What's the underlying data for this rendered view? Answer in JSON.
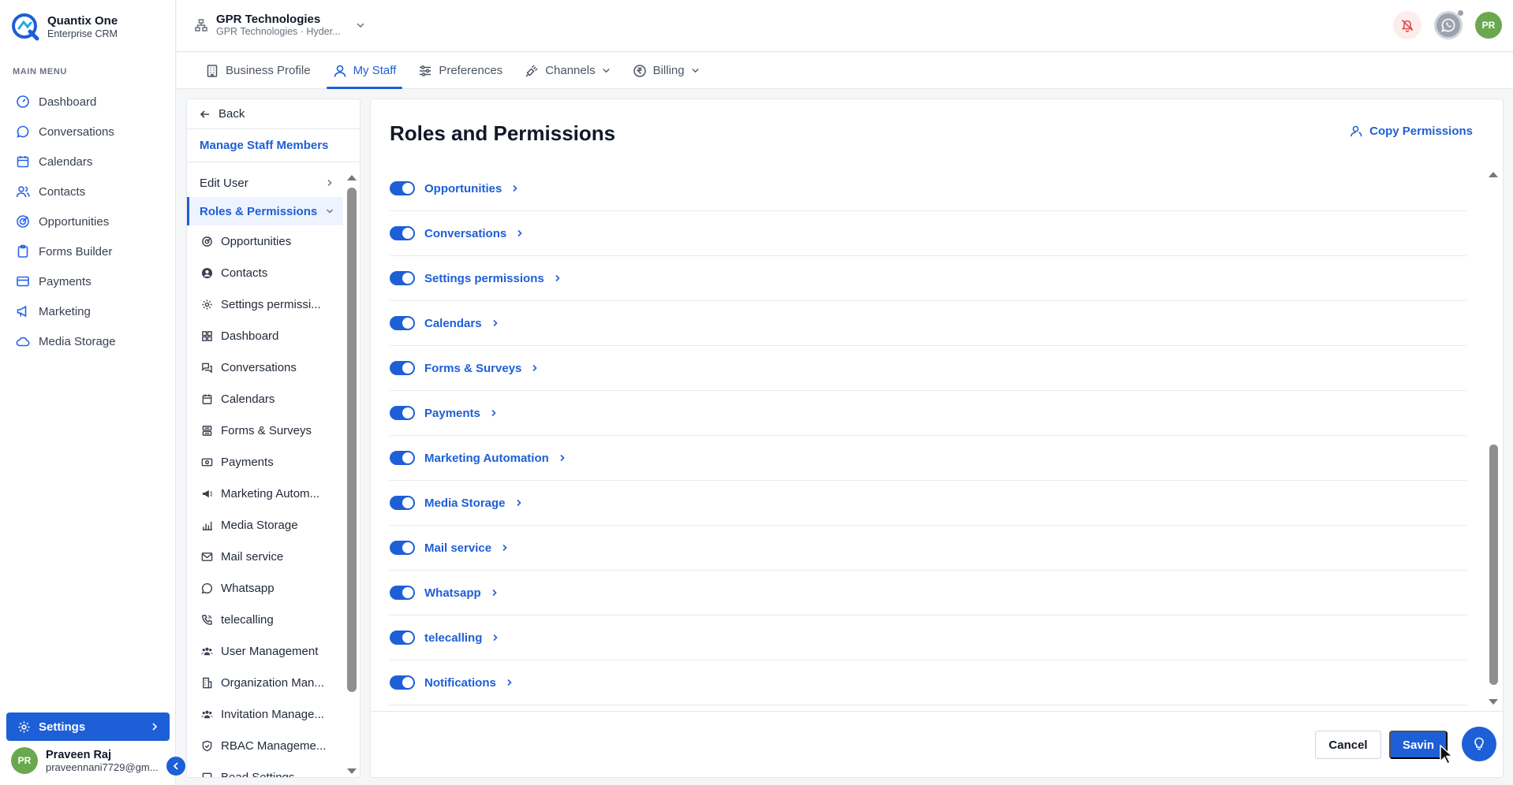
{
  "brand": {
    "name": "Quantix One",
    "subtitle": "Enterprise CRM"
  },
  "sidebar": {
    "menu_label": "MAIN MENU",
    "items": [
      {
        "label": "Dashboard",
        "icon": "dashboard-icon"
      },
      {
        "label": "Conversations",
        "icon": "chat-icon"
      },
      {
        "label": "Calendars",
        "icon": "calendar-icon"
      },
      {
        "label": "Contacts",
        "icon": "contacts-icon"
      },
      {
        "label": "Opportunities",
        "icon": "target-icon"
      },
      {
        "label": "Forms Builder",
        "icon": "clipboard-icon"
      },
      {
        "label": "Payments",
        "icon": "payments-icon"
      },
      {
        "label": "Marketing",
        "icon": "megaphone-icon"
      },
      {
        "label": "Media Storage",
        "icon": "cloud-icon"
      }
    ],
    "settings_label": "Settings",
    "user": {
      "initials": "PR",
      "name": "Praveen Raj",
      "email": "praveennani7729@gm..."
    }
  },
  "header": {
    "org_name": "GPR Technologies",
    "org_sub": "GPR Technologies · Hyder...",
    "avatar_initials": "PR"
  },
  "tabs": [
    {
      "label": "Business Profile"
    },
    {
      "label": "My Staff"
    },
    {
      "label": "Preferences"
    },
    {
      "label": "Channels"
    },
    {
      "label": "Billing"
    }
  ],
  "subpanel": {
    "back_label": "Back",
    "title": "Manage Staff Members",
    "edit_user": "Edit User",
    "roles_permissions": "Roles & Permissions",
    "items": [
      "Opportunities",
      "Contacts",
      "Settings permissi...",
      "Dashboard",
      "Conversations",
      "Calendars",
      "Forms & Surveys",
      "Payments",
      "Marketing Autom...",
      "Media Storage",
      "Mail service",
      "Whatsapp",
      "telecalling",
      "User Management",
      "Organization Man...",
      "Invitation Manage...",
      "RBAC Manageme...",
      "Bead Settings"
    ]
  },
  "main": {
    "title": "Roles and Permissions",
    "copy_label": "Copy Permissions",
    "permissions": [
      {
        "label": "Opportunities",
        "enabled": true
      },
      {
        "label": "Conversations",
        "enabled": true
      },
      {
        "label": "Settings permissions",
        "enabled": true
      },
      {
        "label": "Calendars",
        "enabled": true
      },
      {
        "label": "Forms & Surveys",
        "enabled": true
      },
      {
        "label": "Payments",
        "enabled": true
      },
      {
        "label": "Marketing Automation",
        "enabled": true
      },
      {
        "label": "Media Storage",
        "enabled": true
      },
      {
        "label": "Mail service",
        "enabled": true
      },
      {
        "label": "Whatsapp",
        "enabled": true
      },
      {
        "label": "telecalling",
        "enabled": true
      },
      {
        "label": "Notifications",
        "enabled": true
      }
    ],
    "cancel_label": "Cancel",
    "save_label": "Savin"
  },
  "colors": {
    "accent": "#1d5fd6",
    "avatar": "#6aa84f"
  }
}
